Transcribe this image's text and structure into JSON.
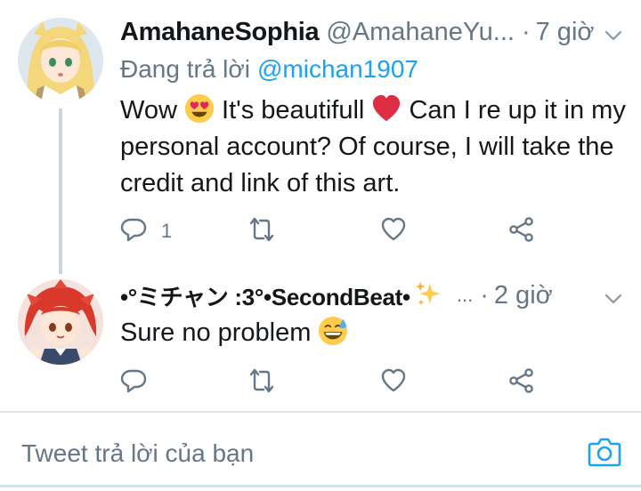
{
  "tweet1": {
    "name": "AmahaneSophia",
    "handle": "@AmahaneYu",
    "ellipsis": "...",
    "dot": "·",
    "time": "7 giờ",
    "reply_prefix": "Đang trả lời",
    "reply_mention": "@michan1907",
    "text_part1": "Wow",
    "text_part2": "It's beautifull",
    "text_part3": "Can I re up it in my personal account? Of course, I will take the credit and link of this art.",
    "reply_count": "1",
    "emojis": [
      "heart-eyes-emoji",
      "red-heart-emoji"
    ]
  },
  "tweet2": {
    "name": "•°ミチャン :3°•SecondBeat•",
    "ellipsis": "...",
    "dot": "·",
    "time": "2 giờ",
    "text": "Sure no problem",
    "emojis": [
      "sparkles-emoji",
      "grinning-sweat-emoji"
    ]
  },
  "composer": {
    "placeholder": "Tweet trả lời của bạn"
  },
  "colors": {
    "accent": "#1da1f2",
    "secondary_text": "#657786",
    "primary_text": "#14171a",
    "heart_red": "#e0245e",
    "emoji_yellow": "#ffcc4d"
  },
  "icons": [
    "chevron-down-icon",
    "reply-icon",
    "retweet-icon",
    "like-icon",
    "share-icon",
    "camera-icon"
  ]
}
